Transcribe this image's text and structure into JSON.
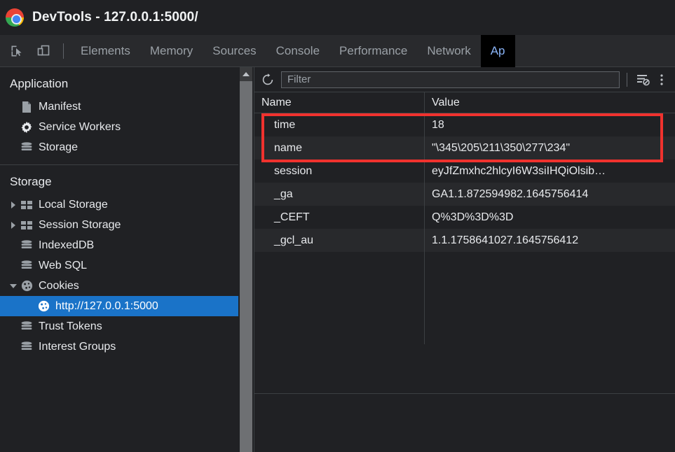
{
  "titlebar": {
    "icon": "chrome-logo-icon",
    "title": "DevTools - 127.0.0.1:5000/"
  },
  "tabbar": {
    "inspect_icon": "inspect-element-icon",
    "device_icon": "device-toolbar-icon",
    "tabs": [
      {
        "label": "Elements",
        "active": false
      },
      {
        "label": "Memory",
        "active": false
      },
      {
        "label": "Sources",
        "active": false
      },
      {
        "label": "Console",
        "active": false
      },
      {
        "label": "Performance",
        "active": false
      },
      {
        "label": "Network",
        "active": false
      },
      {
        "label": "Ap",
        "active": true
      }
    ]
  },
  "sidebar": {
    "sections": [
      {
        "title": "Application",
        "items": [
          {
            "label": "Manifest",
            "icon": "manifest-document-icon",
            "twisty": "none",
            "selected": false,
            "child": false
          },
          {
            "label": "Service Workers",
            "icon": "gear-icon",
            "twisty": "none",
            "selected": false,
            "child": false
          },
          {
            "label": "Storage",
            "icon": "database-icon",
            "twisty": "none",
            "selected": false,
            "child": false
          }
        ]
      },
      {
        "title": "Storage",
        "items": [
          {
            "label": "Local Storage",
            "icon": "table-grid-icon",
            "twisty": "collapsed",
            "selected": false,
            "child": false
          },
          {
            "label": "Session Storage",
            "icon": "table-grid-icon",
            "twisty": "collapsed",
            "selected": false,
            "child": false
          },
          {
            "label": "IndexedDB",
            "icon": "database-icon",
            "twisty": "none",
            "selected": false,
            "child": false
          },
          {
            "label": "Web SQL",
            "icon": "database-icon",
            "twisty": "none",
            "selected": false,
            "child": false
          },
          {
            "label": "Cookies",
            "icon": "cookie-icon",
            "twisty": "expanded",
            "selected": false,
            "child": false
          },
          {
            "label": "http://127.0.0.1:5000",
            "icon": "cookie-icon",
            "twisty": "none",
            "selected": true,
            "child": true
          },
          {
            "label": "Trust Tokens",
            "icon": "database-icon",
            "twisty": "none",
            "selected": false,
            "child": false
          },
          {
            "label": "Interest Groups",
            "icon": "database-icon",
            "twisty": "none",
            "selected": false,
            "child": false
          }
        ]
      }
    ],
    "scrollbar": {
      "up_arrow_icon": "scroll-up-arrow-icon"
    }
  },
  "main": {
    "toolbar": {
      "refresh_icon": "refresh-icon",
      "filter_placeholder": "Filter",
      "filter_value": "",
      "clear_filter_icon": "clear-filter-icon",
      "overflow_icon": "more-options-icon"
    },
    "table": {
      "columns": [
        "Name",
        "Value"
      ],
      "rows": [
        {
          "name": "time",
          "value": "18"
        },
        {
          "name": "name",
          "value": "\"\\345\\205\\211\\350\\277\\234\""
        },
        {
          "name": "session",
          "value": "eyJfZmxhc2hlcyI6W3siIHQiOlsib…"
        },
        {
          "name": "_ga",
          "value": "GA1.1.872594982.1645756414"
        },
        {
          "name": "_CEFT",
          "value": "Q%3D%3D%3D"
        },
        {
          "name": "_gcl_au",
          "value": "1.1.1758641027.1645756412"
        }
      ]
    },
    "annotation": {
      "type": "red-highlight-box",
      "covers_rows": [
        "time",
        "name"
      ],
      "color": "#f0322e"
    }
  },
  "colors": {
    "background": "#202124",
    "panel_background": "#292a2d",
    "selection_blue": "#1a73c8",
    "tab_active_text": "#8ab4f8",
    "text_primary": "#e8eaed",
    "text_secondary": "#9aa0a6",
    "annotation_red": "#f0322e"
  }
}
